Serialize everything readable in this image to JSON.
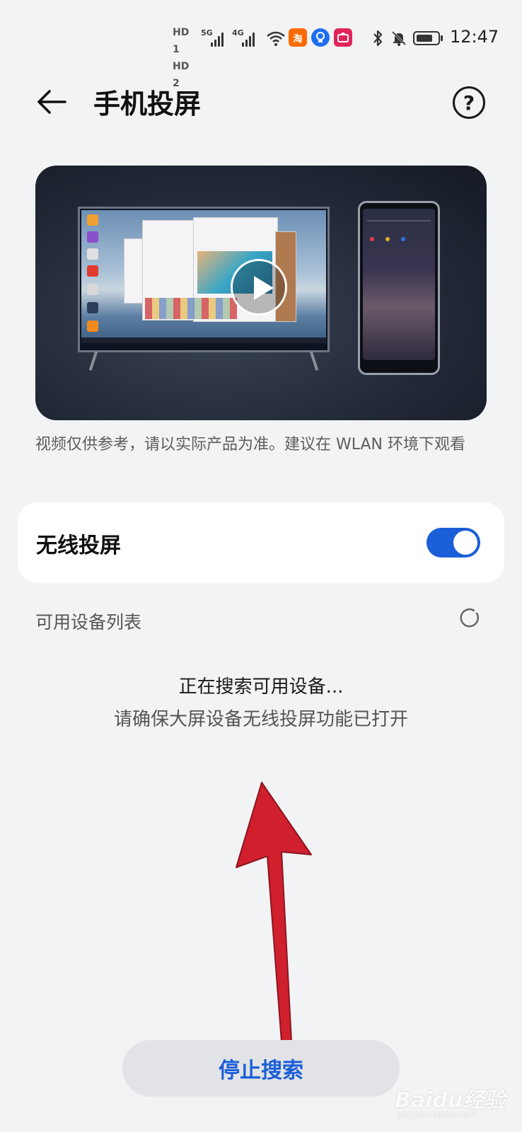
{
  "status_bar": {
    "hd1": "HD 1",
    "hd2": "HD 2",
    "net1": "5G",
    "net2": "4G",
    "time": "12:47",
    "battery_level": 0.85,
    "icons": [
      "signal-icon",
      "wifi-icon",
      "taobao-app-icon",
      "bulb-app-icon",
      "shopping-app-icon",
      "bluetooth-icon",
      "bell-muted-icon",
      "battery-icon"
    ]
  },
  "header": {
    "title": "手机投屏",
    "help_label": "?"
  },
  "video": {
    "disclaimer": "视频仅供参考，请以实际产品为准。建议在 WLAN 环境下观看"
  },
  "wireless": {
    "label": "无线投屏",
    "enabled": true,
    "accent": "#1a5ed8"
  },
  "devices": {
    "header": "可用设备列表",
    "searching": "正在搜索可用设备...",
    "hint": "请确保大屏设备无线投屏功能已打开"
  },
  "footer": {
    "stop_label": "停止搜索"
  },
  "watermark": {
    "text": "Baidu经验",
    "sub": "jingyan.baidu.com"
  },
  "colors": {
    "background": "#f1f3f5",
    "accent": "#1a5ed8",
    "annotation_arrow": "#d0202e"
  }
}
